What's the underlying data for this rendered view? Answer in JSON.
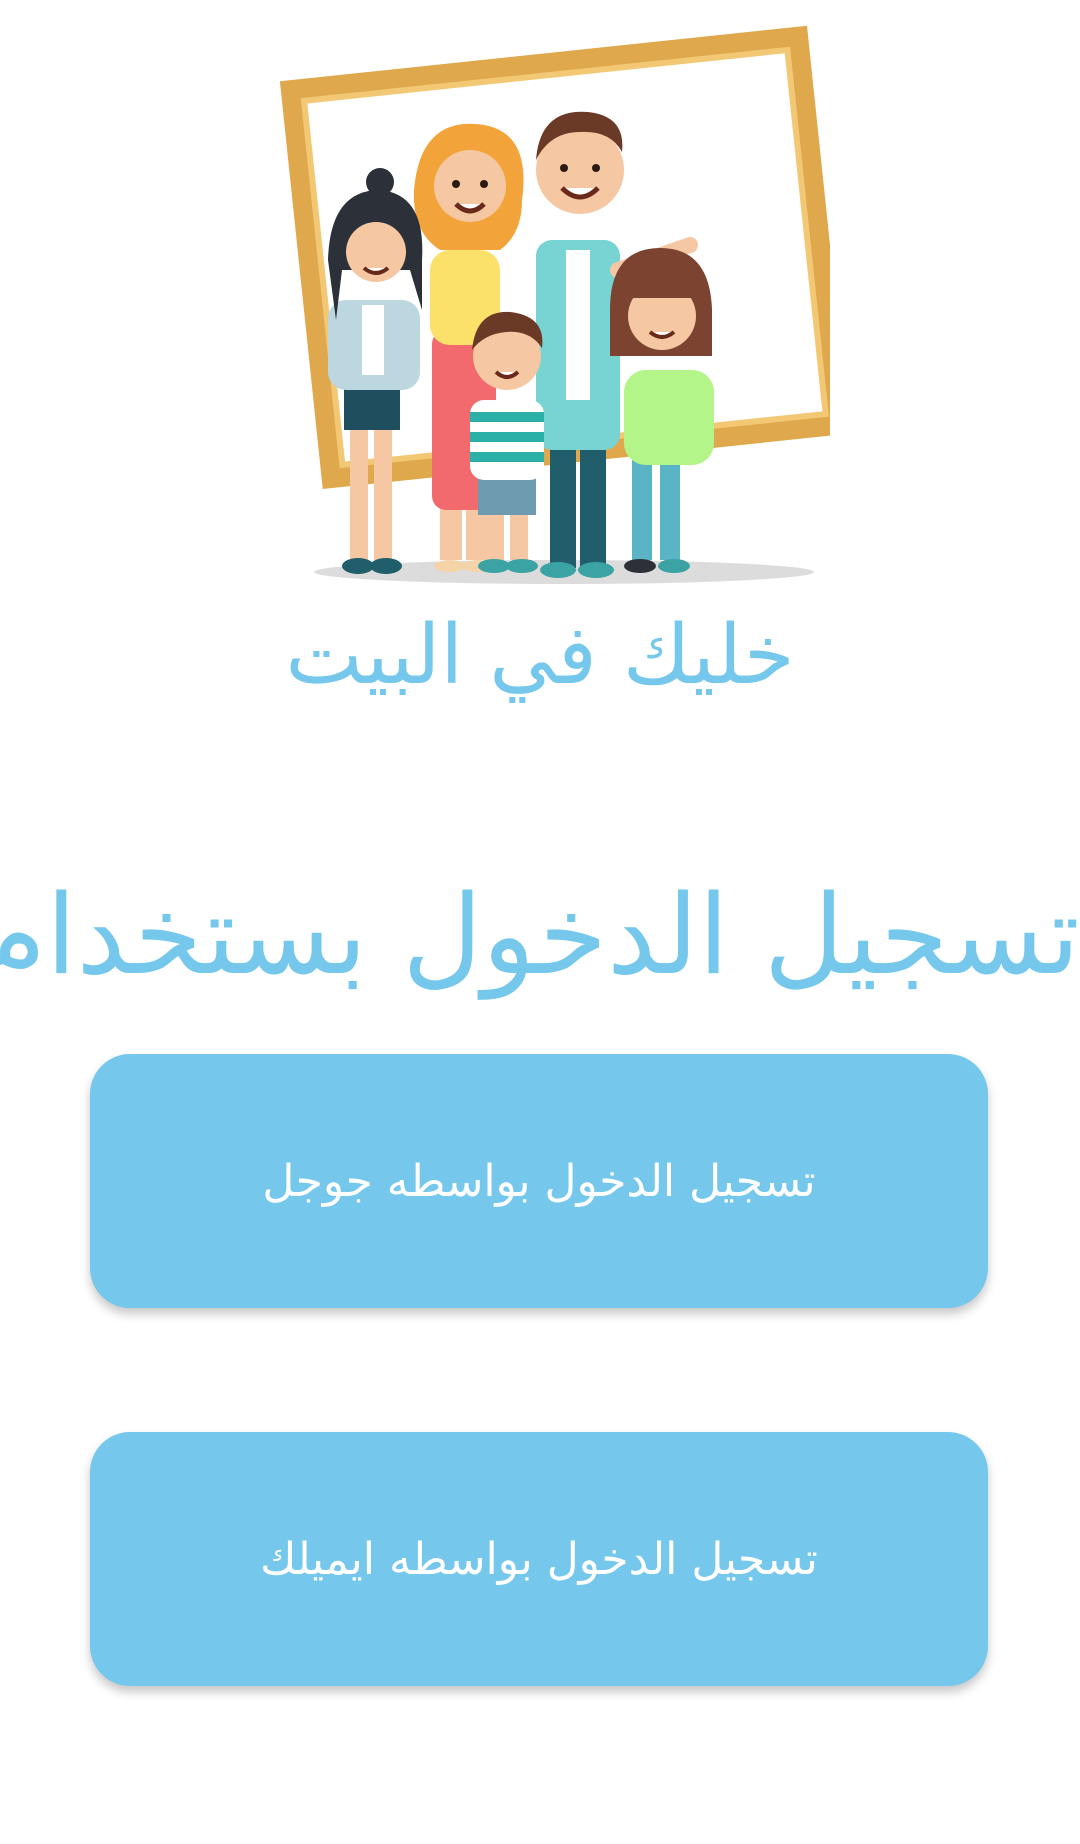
{
  "app": {
    "name": "خليك في البيت"
  },
  "login": {
    "heading": "تسجيل الدخول بستخدام",
    "google_button_label": "تسجيل الدخول بواسطه جوجل",
    "email_button_label": "تسجيل الدخول بواسطه ايميلك"
  },
  "colors": {
    "accent": "#75c8ec",
    "button_text": "#ffffff",
    "background": "#ffffff"
  },
  "illustration": {
    "icon": "family-picture-frame-illustration"
  }
}
